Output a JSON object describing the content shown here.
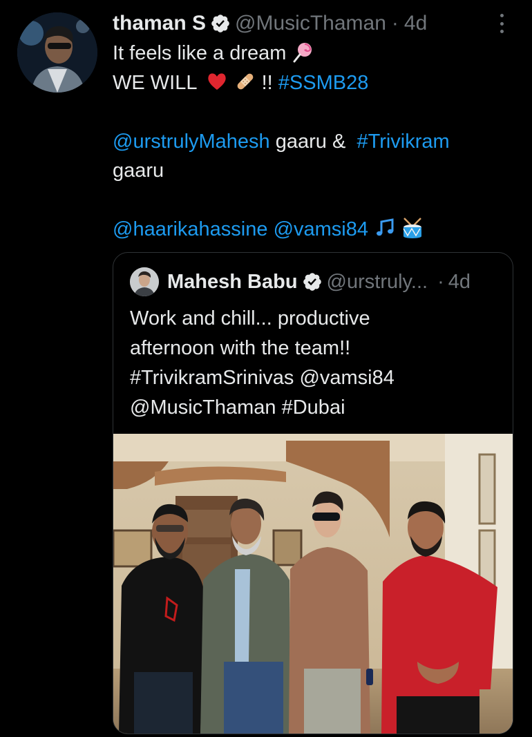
{
  "tweet": {
    "display_name": "thaman S",
    "handle": "@MusicThaman",
    "separator": "·",
    "time": "4d",
    "lines": {
      "l1": "It feels like a dream",
      "l2_text": "WE WILL",
      "l2_after": " !!",
      "l2_hashtag": "#SSMB28",
      "l3_mention": "@urstrulyMahesh",
      "l3_mid": " gaaru & ",
      "l3_hashtag": "#Trivikram",
      "l4": "gaaru",
      "l5_mention1": "@haarikahassine",
      "l5_mention2": "@vamsi84"
    },
    "emojis": [
      "lollipop-emoji",
      "red-heart-emoji",
      "bandage-emoji",
      "musical-notes-emoji",
      "drum-emoji"
    ]
  },
  "quote": {
    "display_name": "Mahesh Babu",
    "handle": "@urstruly...",
    "separator": "·",
    "time": "4d",
    "lines": [
      "Work and chill... productive",
      "afternoon with the team!!",
      "#TrivikramSrinivas @vamsi84",
      "@MusicThaman #Dubai"
    ]
  },
  "colors": {
    "background": "#000000",
    "text": "#e7e9ea",
    "muted": "#71767b",
    "link": "#1d9bf0",
    "border": "#2f3336",
    "verified_badge": "#e7e9ea"
  }
}
